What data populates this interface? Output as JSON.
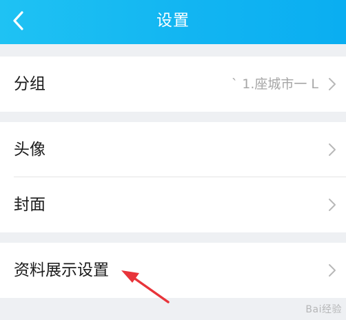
{
  "header": {
    "title": "设置",
    "back_icon": "chevron-left-icon",
    "background_color": "#12b5f2"
  },
  "groups": [
    {
      "rows": [
        {
          "label": "分组",
          "value": "` 1.座城市一 L"
        }
      ]
    },
    {
      "rows": [
        {
          "label": "头像"
        },
        {
          "label": "封面"
        }
      ]
    },
    {
      "rows": [
        {
          "label": "资料展示设置"
        }
      ]
    }
  ],
  "annotation": {
    "type": "red-arrow",
    "color": "#e8343a"
  },
  "watermark": "Bai经验"
}
